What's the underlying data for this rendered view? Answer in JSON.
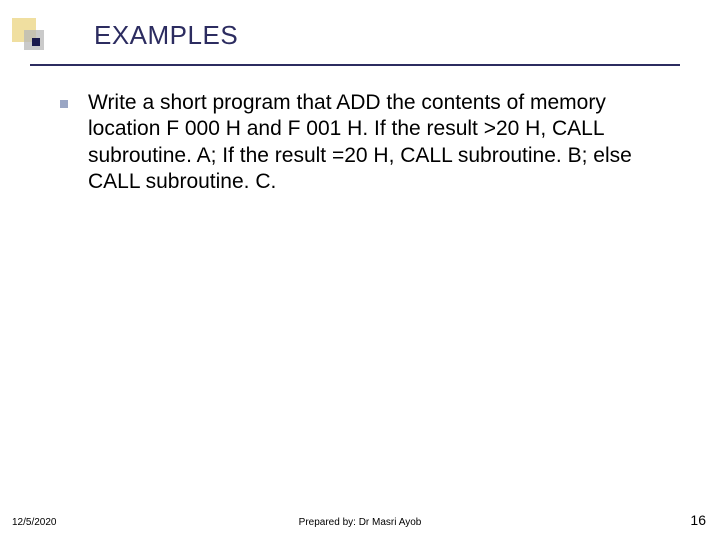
{
  "colors": {
    "accent_navy": "#2c2c60",
    "accent_yellow": "#f0dfa0",
    "accent_grey": "#b8b8b8",
    "bullet": "#9aa6c4"
  },
  "title": "EXAMPLES",
  "bullets": [
    "Write a short program that ADD the contents of memory location F 000 H and F 001 H. If the result >20 H, CALL  subroutine. A; If the result  =20 H, CALL  subroutine. B; else CALL  subroutine. C."
  ],
  "footer": {
    "date": "12/5/2020",
    "center": "Prepared by: Dr Masri Ayob",
    "page": "16"
  }
}
